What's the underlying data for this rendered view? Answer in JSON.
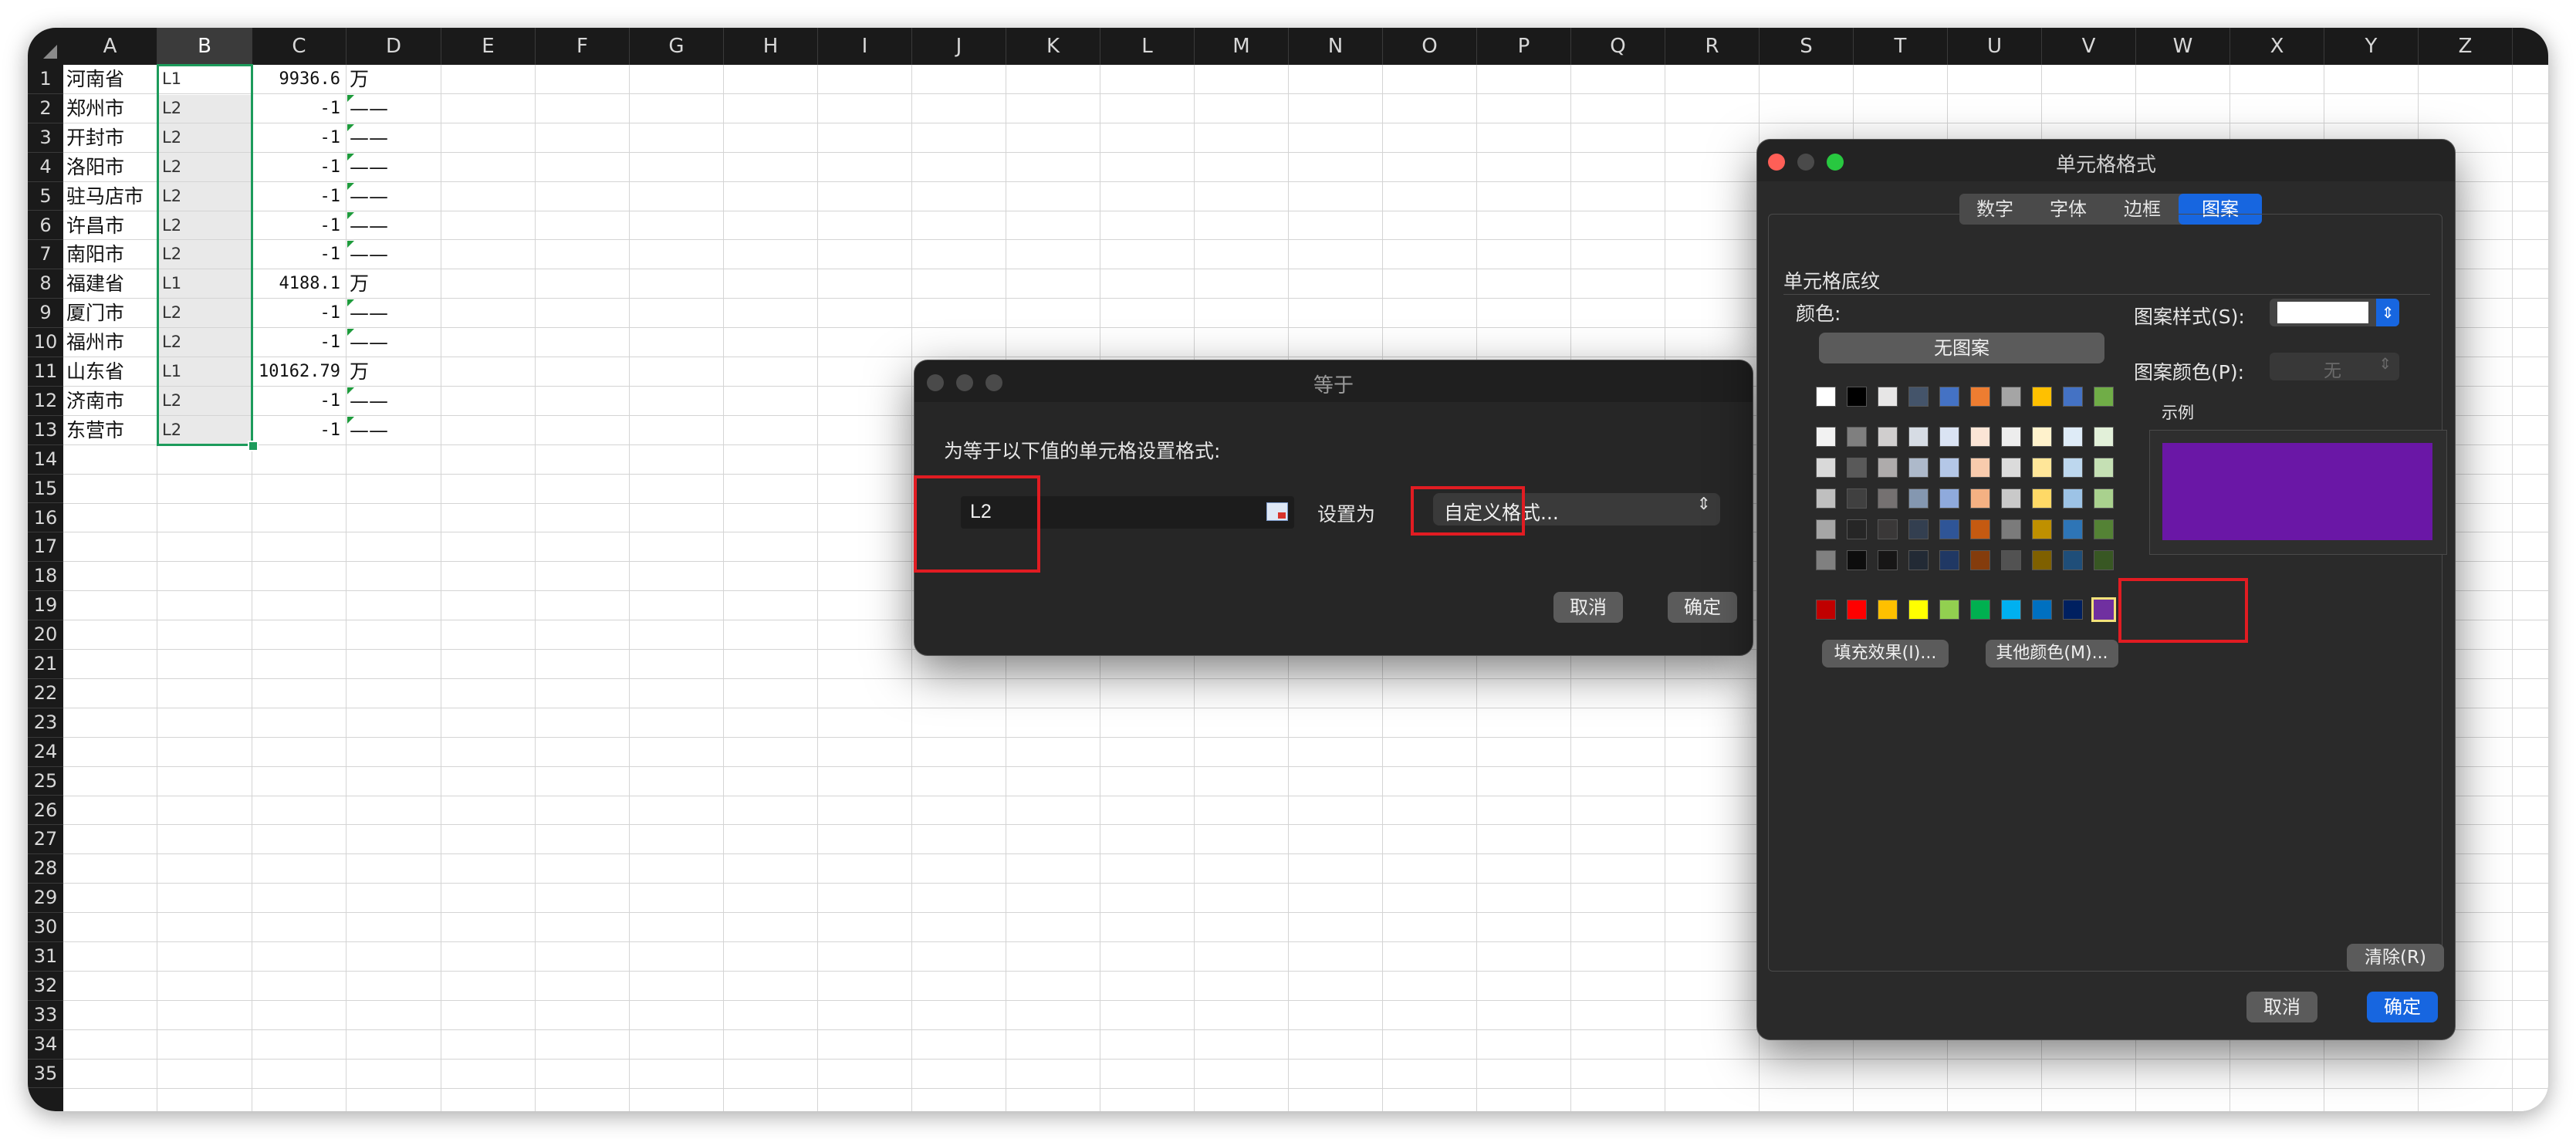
{
  "sheet": {
    "columns": [
      "A",
      "B",
      "C",
      "D",
      "E",
      "F",
      "G",
      "H",
      "I",
      "J",
      "K",
      "L",
      "M",
      "N",
      "O",
      "P",
      "Q",
      "R",
      "S",
      "T",
      "U",
      "V",
      "W",
      "X",
      "Y",
      "Z"
    ],
    "rows": [
      "1",
      "2",
      "3",
      "4",
      "5",
      "6",
      "7",
      "8",
      "9",
      "10",
      "11",
      "12",
      "13",
      "14",
      "15",
      "16",
      "17",
      "18",
      "19",
      "20",
      "21",
      "22",
      "23",
      "24",
      "25",
      "26",
      "27",
      "28",
      "29",
      "30",
      "31",
      "32",
      "33",
      "34",
      "35"
    ],
    "data": [
      {
        "a": "河南省",
        "b": "L1",
        "c": "9936.6",
        "d": "万"
      },
      {
        "a": "郑州市",
        "b": "L2",
        "c": "-1",
        "d": "——"
      },
      {
        "a": "开封市",
        "b": "L2",
        "c": "-1",
        "d": "——"
      },
      {
        "a": "洛阳市",
        "b": "L2",
        "c": "-1",
        "d": "——"
      },
      {
        "a": "驻马店市",
        "b": "L2",
        "c": "-1",
        "d": "——"
      },
      {
        "a": "许昌市",
        "b": "L2",
        "c": "-1",
        "d": "——"
      },
      {
        "a": "南阳市",
        "b": "L2",
        "c": "-1",
        "d": "——"
      },
      {
        "a": "福建省",
        "b": "L1",
        "c": "4188.1",
        "d": "万"
      },
      {
        "a": "厦门市",
        "b": "L2",
        "c": "-1",
        "d": "——"
      },
      {
        "a": "福州市",
        "b": "L2",
        "c": "-1",
        "d": "——"
      },
      {
        "a": "山东省",
        "b": "L1",
        "c": "10162.79",
        "d": "万"
      },
      {
        "a": "济南市",
        "b": "L2",
        "c": "-1",
        "d": "——"
      },
      {
        "a": "东营市",
        "b": "L2",
        "c": "-1",
        "d": "——"
      }
    ]
  },
  "equal_dialog": {
    "title": "等于",
    "prompt": "为等于以下值的单元格设置格式:",
    "value": "L2",
    "set_as_label": "设置为",
    "format_value": "自定义格式...",
    "cancel": "取消",
    "ok": "确定"
  },
  "format_dialog": {
    "title": "单元格格式",
    "tabs": [
      "数字",
      "字体",
      "边框",
      "图案"
    ],
    "active_tab": "图案",
    "section": "单元格底纹",
    "color_label": "颜色:",
    "no_pattern": "无图案",
    "pattern_style_label": "图案样式(S):",
    "pattern_color_label": "图案颜色(P):",
    "pattern_color_value": "无",
    "sample_label": "示例",
    "sample_color": "#6a17a6",
    "fill_effects": "填充效果(I)...",
    "more_colors": "其他颜色(M)...",
    "clear": "清除(R)",
    "cancel": "取消",
    "ok": "确定",
    "palette_top": [
      "#ffffff",
      "#000000",
      "#e7e6e6",
      "#44546a",
      "#4472c4",
      "#ed7d31",
      "#a5a5a5",
      "#ffc000",
      "#4472c4",
      "#70ad47"
    ],
    "palette_tints": [
      [
        "#f2f2f2",
        "#7f7f7f",
        "#d0cece",
        "#d6dce4",
        "#dae3f3",
        "#fbe5d6",
        "#ededed",
        "#fff2cc",
        "#deebf7",
        "#e2f0d9"
      ],
      [
        "#d9d9d9",
        "#595959",
        "#aeabab",
        "#adb9ca",
        "#b4c7e7",
        "#f8cbad",
        "#dbdbdb",
        "#ffe699",
        "#bdd7ee",
        "#c5e0b4"
      ],
      [
        "#bfbfbf",
        "#404040",
        "#757171",
        "#8497b0",
        "#8faadc",
        "#f4b183",
        "#c9c9c9",
        "#ffd966",
        "#9dc3e6",
        "#a9d18e"
      ],
      [
        "#a6a6a6",
        "#262626",
        "#3a3838",
        "#333f50",
        "#2f5597",
        "#c55a11",
        "#7b7b7b",
        "#bf9000",
        "#2e75b6",
        "#548235"
      ],
      [
        "#808080",
        "#0d0d0d",
        "#171616",
        "#222a35",
        "#203864",
        "#843c0c",
        "#525252",
        "#7f6000",
        "#1f4e79",
        "#385723"
      ]
    ],
    "palette_standard": [
      "#c00000",
      "#ff0000",
      "#ffc000",
      "#ffff00",
      "#92d050",
      "#00b050",
      "#00b0f0",
      "#0070c0",
      "#002060",
      "#7030a0"
    ]
  }
}
